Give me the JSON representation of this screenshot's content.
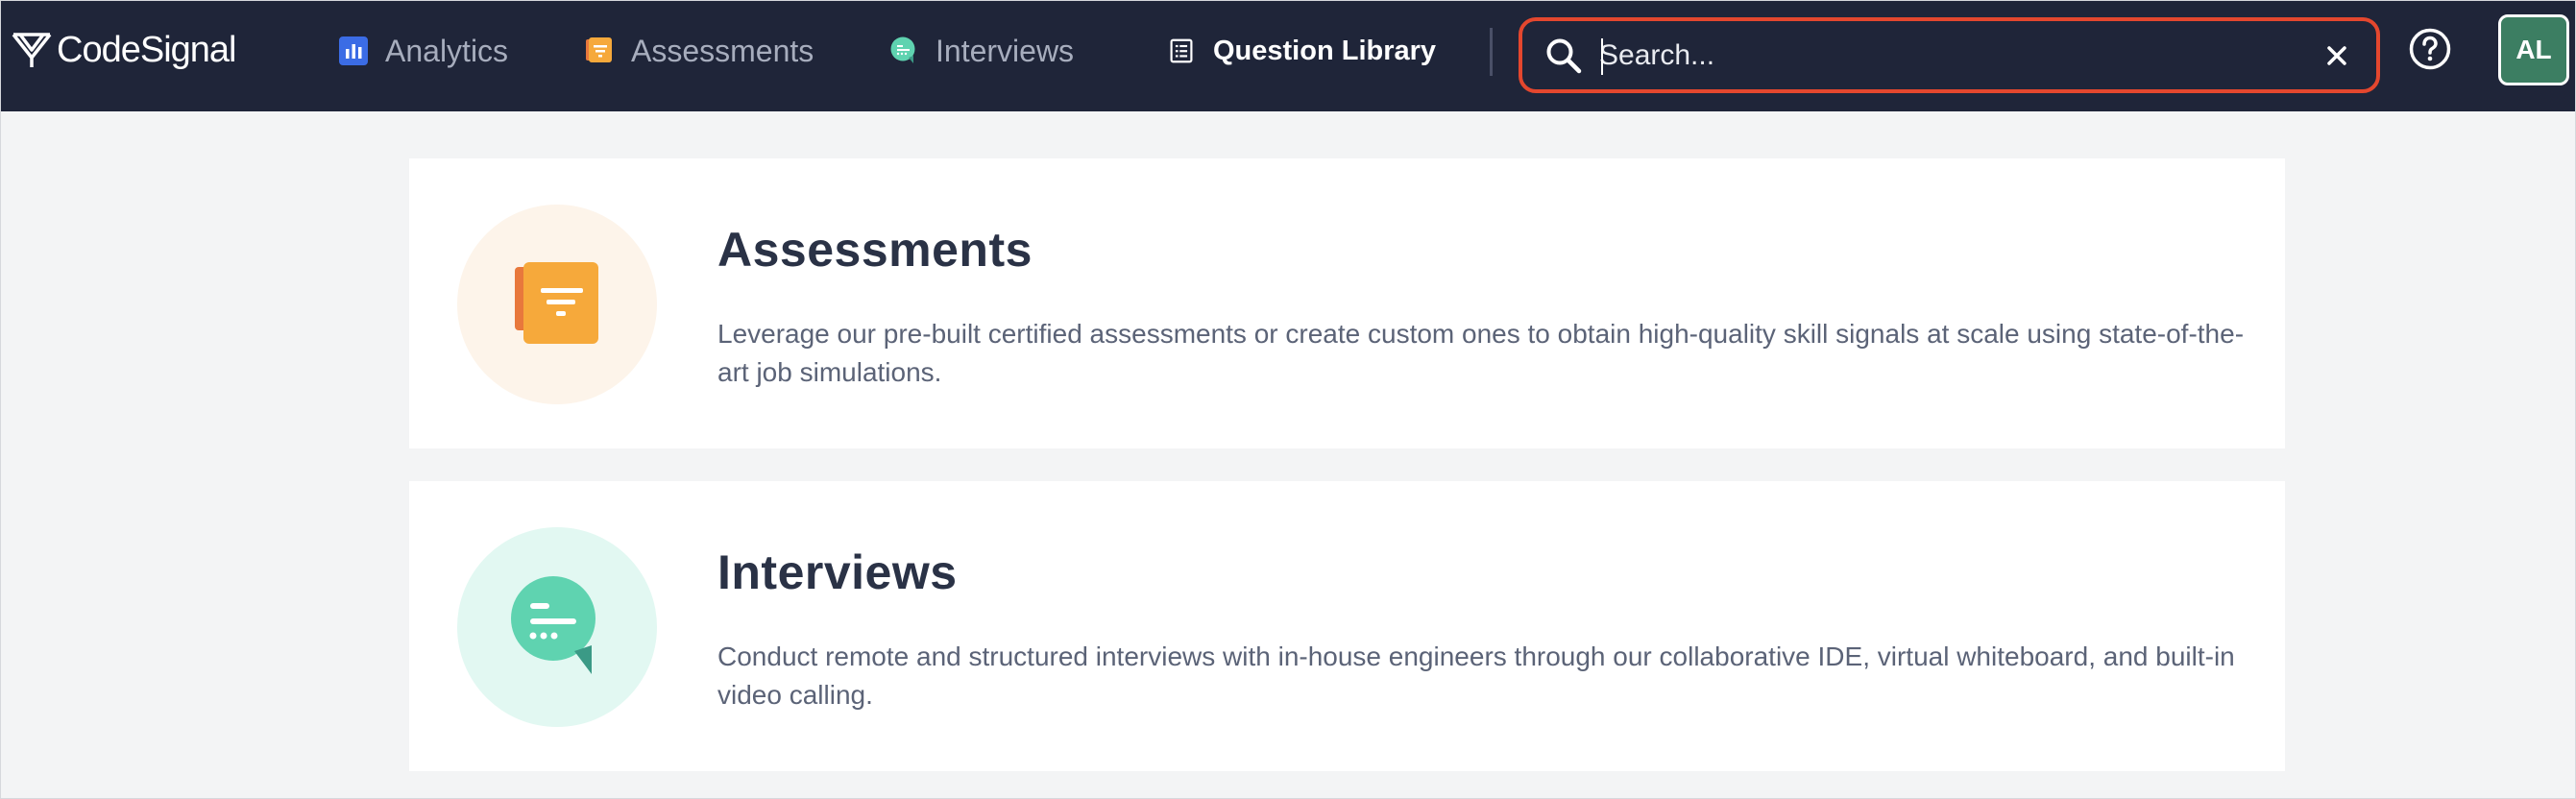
{
  "app": {
    "logo_text": "CodeSignal"
  },
  "nav": {
    "items": [
      {
        "label": "Analytics",
        "icon": "bar-chart-icon",
        "color": "#3b6ce5"
      },
      {
        "label": "Assessments",
        "icon": "assessment-scroll-icon",
        "color": "#f0a53c"
      },
      {
        "label": "Interviews",
        "icon": "chat-bubble-icon",
        "color": "#5fd3b0"
      },
      {
        "label": "Question Library",
        "icon": "list-document-icon",
        "color": "#ffffff"
      }
    ]
  },
  "search": {
    "placeholder": "Search...",
    "value": "",
    "highlight_color": "#e4472e"
  },
  "user": {
    "initials": "AL",
    "avatar_color": "#3c7e62"
  },
  "cards": [
    {
      "title": "Assessments",
      "description": "Leverage our pre-built certified assessments or create custom ones to obtain high-quality skill signals at scale using state-of-the-art job simulations."
    },
    {
      "title": "Interviews",
      "description": "Conduct remote and structured interviews with in-house engineers through our collaborative IDE, virtual whiteboard, and built-in video calling."
    }
  ]
}
